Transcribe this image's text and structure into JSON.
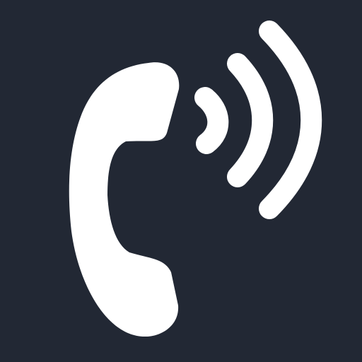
{
  "icon": {
    "name": "phone-ringing-icon",
    "background_color": "#222834",
    "foreground_color": "#FFFFFF"
  }
}
